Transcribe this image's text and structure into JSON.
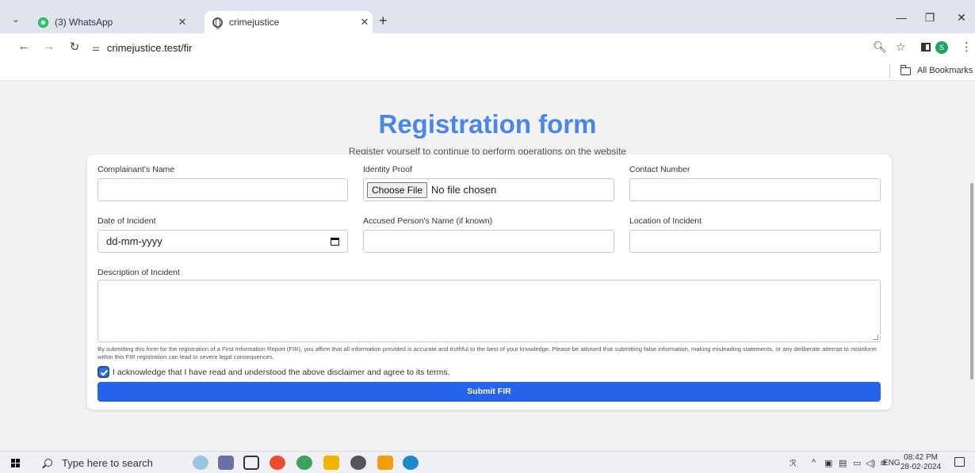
{
  "browser": {
    "tabs": [
      {
        "title": "(3) WhatsApp",
        "icon": "whatsapp-icon"
      },
      {
        "title": "crimejustice",
        "icon": "globe-icon"
      }
    ],
    "url": "crimejustice.test/fir",
    "bookmarks_label": "All Bookmarks",
    "profile_initial": "S"
  },
  "page": {
    "title": "Registration form",
    "subtitle": "Register yourself to continue to perform operations on the website"
  },
  "form": {
    "complainant_label": "Complainant's Name",
    "identity_label": "Identity Proof",
    "choose_file": "Choose File",
    "no_file": "No file chosen",
    "contact_label": "Contact Number",
    "date_label": "Date of Incident",
    "date_placeholder": "dd-mm-yyyy",
    "accused_label": "Accused Person's Name (if known)",
    "location_label": "Location of Incident",
    "description_label": "Description of Incident",
    "disclaimer": "By submitting this form for the registration of a First Information Report (FIR), you affirm that all information provided is accurate and truthful to the best of your knowledge. Please be advised that submitting false information, making misleading statements, or any deliberate attempt to misinform within this FIR registration can lead to severe legal consequences.",
    "acknowledge": "I acknowledge that I have read and understood the above disclaimer and agree to its terms.",
    "acknowledge_checked": true,
    "submit": "Submit FIR"
  },
  "taskbar": {
    "search_placeholder": "Type here to search",
    "language": "ENG",
    "time": "08:42 PM",
    "date": "28-02-2024"
  },
  "colors": {
    "accent": "#2563eb",
    "title": "#4a86e8"
  }
}
